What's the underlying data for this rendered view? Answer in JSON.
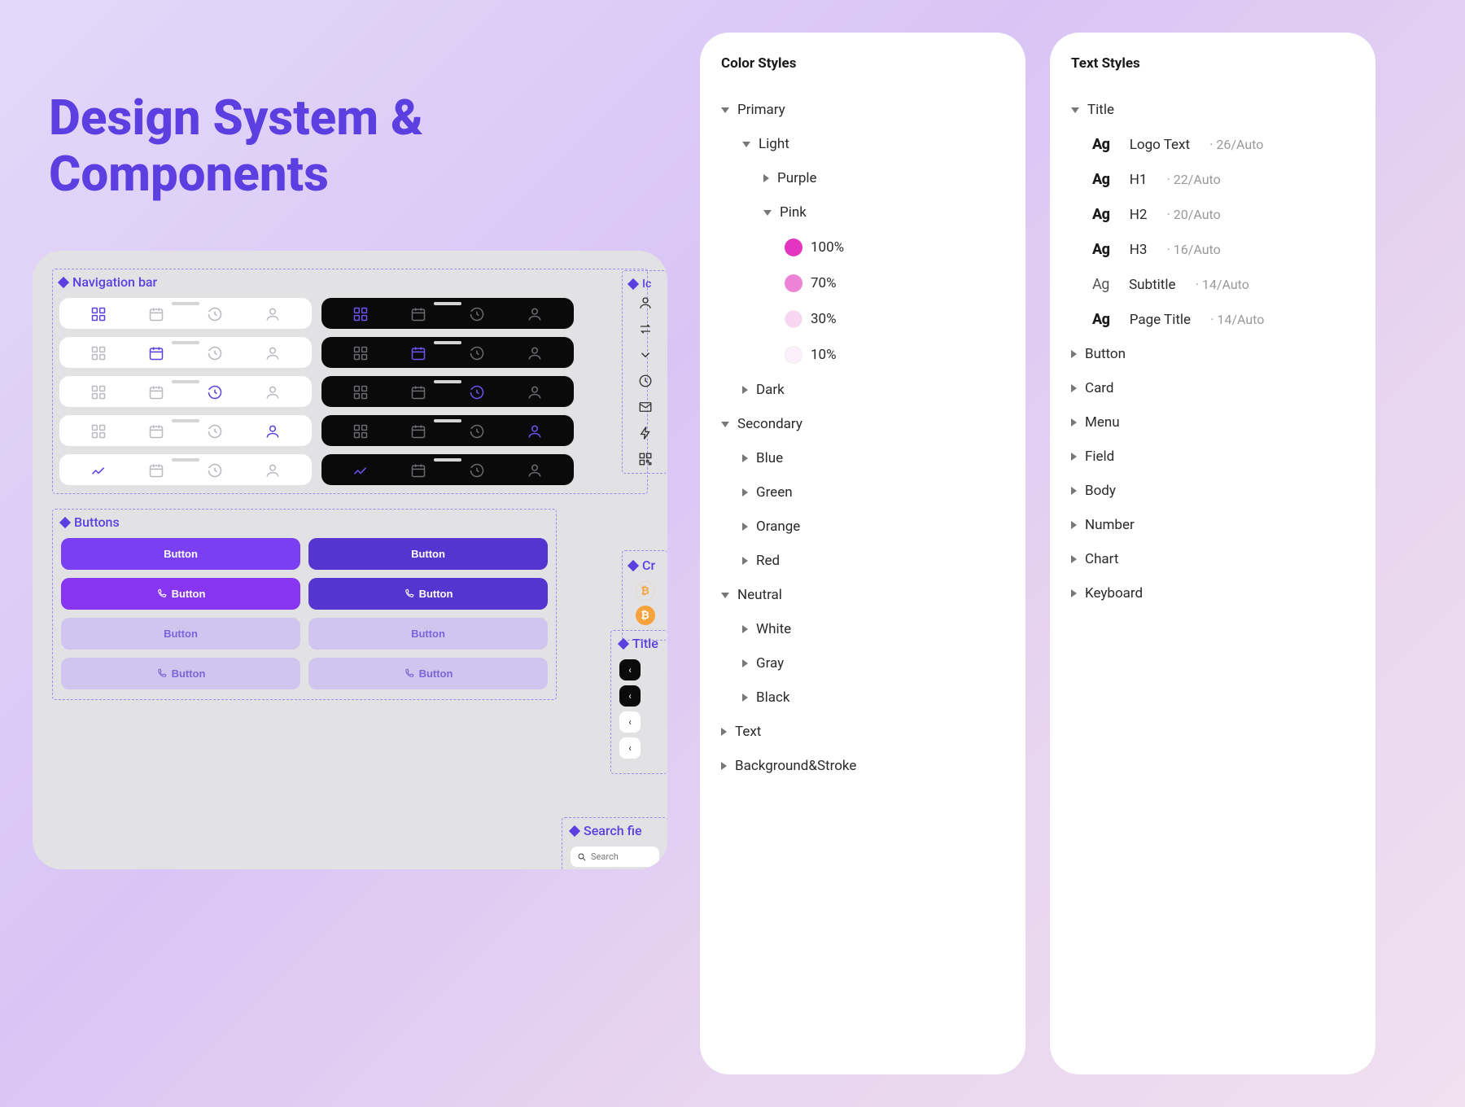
{
  "page_title": "Design System & Components",
  "preview": {
    "nav_label": "Navigation bar",
    "icons_label": "Ic",
    "crypt_label": "Cr",
    "buttons_label": "Buttons",
    "title_label": "Title",
    "search_label": "Search fie",
    "nav_icons": [
      "grid",
      "calendar",
      "history",
      "user"
    ],
    "button_text": "Button",
    "search_placeholder": "Search"
  },
  "color_panel": {
    "title": "Color Styles",
    "primary": "Primary",
    "light": "Light",
    "purple": "Purple",
    "pink": "Pink",
    "opacities": [
      "100%",
      "70%",
      "30%",
      "10%"
    ],
    "dark": "Dark",
    "secondary": "Secondary",
    "blue": "Blue",
    "green": "Green",
    "orange": "Orange",
    "red": "Red",
    "neutral": "Neutral",
    "white": "White",
    "gray": "Gray",
    "black": "Black",
    "text": "Text",
    "bg": "Background&Stroke"
  },
  "text_panel": {
    "title": "Text Styles",
    "title_group": "Title",
    "ag": "Ag",
    "styles": [
      {
        "name": "Logo Text",
        "meta": "26/Auto"
      },
      {
        "name": "H1",
        "meta": "22/Auto"
      },
      {
        "name": "H2",
        "meta": "20/Auto"
      },
      {
        "name": "H3",
        "meta": "16/Auto"
      },
      {
        "name": "Subtitle",
        "meta": "14/Auto"
      },
      {
        "name": "Page Title",
        "meta": "14/Auto"
      }
    ],
    "groups": [
      "Button",
      "Card",
      "Menu",
      "Field",
      "Body",
      "Number",
      "Chart",
      "Keyboard"
    ]
  }
}
